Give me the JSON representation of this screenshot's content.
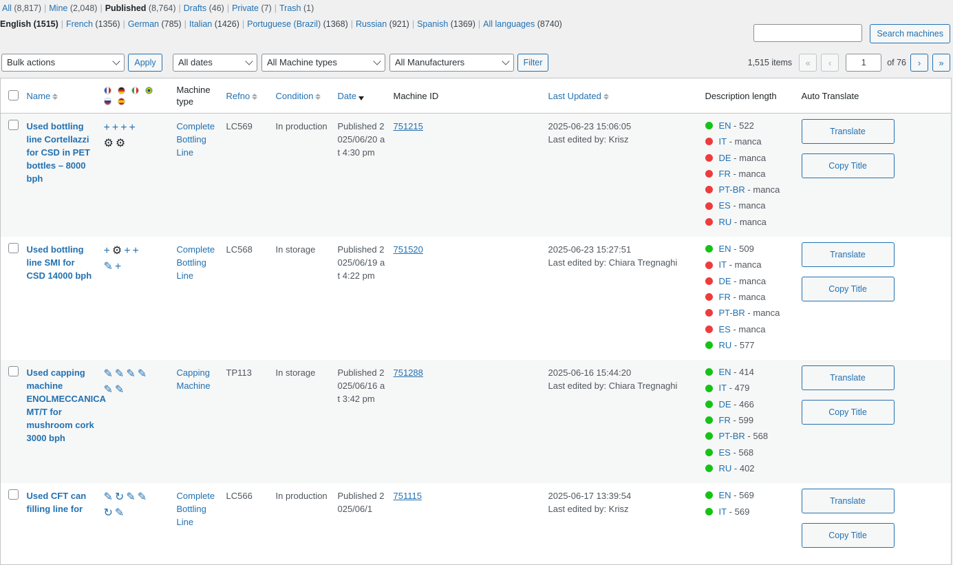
{
  "filters": [
    {
      "label": "All",
      "count": "(8,817)"
    },
    {
      "label": "Mine",
      "count": "(2,048)"
    },
    {
      "label": "Published",
      "count": "(8,764)",
      "current": true
    },
    {
      "label": "Drafts",
      "count": "(46)"
    },
    {
      "label": "Private",
      "count": "(7)"
    },
    {
      "label": "Trash",
      "count": "(1)"
    }
  ],
  "languages": [
    {
      "label": "English",
      "count": "(1515)",
      "current": true
    },
    {
      "label": "French",
      "count": "(1356)"
    },
    {
      "label": "German",
      "count": "(785)"
    },
    {
      "label": "Italian",
      "count": "(1426)"
    },
    {
      "label": "Portuguese (Brazil)",
      "count": "(1368)"
    },
    {
      "label": "Russian",
      "count": "(921)"
    },
    {
      "label": "Spanish",
      "count": "(1369)"
    },
    {
      "label": "All languages",
      "count": "(8740)"
    }
  ],
  "search": {
    "button": "Search machines",
    "value": ""
  },
  "toolbar": {
    "bulk_actions": "Bulk actions",
    "apply": "Apply",
    "dates": "All dates",
    "machine_types": "All Machine types",
    "manufacturers": "All Manufacturers",
    "filter": "Filter"
  },
  "pagination": {
    "items": "1,515 items",
    "first": "«",
    "prev": "‹",
    "current": "1",
    "of": "of 76",
    "next": "›",
    "last": "»"
  },
  "columns": {
    "name": "Name",
    "machine_type": "Machine type",
    "refno": "Refno",
    "condition": "Condition",
    "date": "Date",
    "machine_id": "Machine ID",
    "last_updated": "Last Updated",
    "description_length": "Description length",
    "auto_translate": "Auto Translate"
  },
  "flag_colors": {
    "fr": "#2a52be",
    "de": "#222222",
    "it": "#2e9e3e",
    "br": "#19a33b",
    "ru": "#d52b1e",
    "es": "#e8b300"
  },
  "rows": [
    {
      "title": "Used bottling line Cortellazzi for CSD in PET bottles – 8000 bph",
      "icons": [
        "plus-icon",
        "plus-icon",
        "plus-icon",
        "plus-icon",
        "gear-icon",
        "gear-icon"
      ],
      "machine_type": "Complete Bottling Line",
      "refno": "LC569",
      "condition": "In production",
      "date": "Published 2025/06/20 at 4:30 pm",
      "machine_id": "751215",
      "updated": "2025-06-23 15:06:05",
      "edited": "Last edited by: Krisz",
      "desc": [
        {
          "lang": "EN",
          "value": "522",
          "status": "green"
        },
        {
          "lang": "IT",
          "value": "manca",
          "status": "red"
        },
        {
          "lang": "DE",
          "value": "manca",
          "status": "red"
        },
        {
          "lang": "FR",
          "value": "manca",
          "status": "red"
        },
        {
          "lang": "PT-BR",
          "value": "manca",
          "status": "red"
        },
        {
          "lang": "ES",
          "value": "manca",
          "status": "red"
        },
        {
          "lang": "RU",
          "value": "manca",
          "status": "red"
        }
      ],
      "btn_translate": "Translate",
      "btn_copy": "Copy Title"
    },
    {
      "title": "Used bottling line SMI for CSD 14000 bph",
      "icons": [
        "plus-icon",
        "gear-icon",
        "plus-icon",
        "plus-icon",
        "pencil-icon",
        "plus-icon"
      ],
      "machine_type": "Complete Bottling Line",
      "refno": "LC568",
      "condition": "In storage",
      "date": "Published 2025/06/19 at 4:22 pm",
      "machine_id": "751520",
      "updated": "2025-06-23 15:27:51",
      "edited": "Last edited by: Chiara Tregnaghi",
      "desc": [
        {
          "lang": "EN",
          "value": "509",
          "status": "green"
        },
        {
          "lang": "IT",
          "value": "manca",
          "status": "red"
        },
        {
          "lang": "DE",
          "value": "manca",
          "status": "red"
        },
        {
          "lang": "FR",
          "value": "manca",
          "status": "red"
        },
        {
          "lang": "PT-BR",
          "value": "manca",
          "status": "red"
        },
        {
          "lang": "ES",
          "value": "manca",
          "status": "red"
        },
        {
          "lang": "RU",
          "value": "577",
          "status": "green"
        }
      ],
      "btn_translate": "Translate",
      "btn_copy": "Copy Title"
    },
    {
      "title": "Used capping machine ENOLMECCANICA MT/T for mushroom cork 3000 bph",
      "icons": [
        "pencil-icon",
        "pencil-icon",
        "pencil-icon",
        "pencil-icon",
        "pencil-icon",
        "pencil-icon"
      ],
      "machine_type": "Capping Machine",
      "refno": "TP113",
      "condition": "In storage",
      "date": "Published 2025/06/16 at 3:42 pm",
      "machine_id": "751288",
      "updated": "2025-06-16 15:44:20",
      "edited": "Last edited by: Chiara Tregnaghi",
      "desc": [
        {
          "lang": "EN",
          "value": "414",
          "status": "green"
        },
        {
          "lang": "IT",
          "value": "479",
          "status": "green"
        },
        {
          "lang": "DE",
          "value": "466",
          "status": "green"
        },
        {
          "lang": "FR",
          "value": "599",
          "status": "green"
        },
        {
          "lang": "PT-BR",
          "value": "568",
          "status": "green"
        },
        {
          "lang": "ES",
          "value": "568",
          "status": "green"
        },
        {
          "lang": "RU",
          "value": "402",
          "status": "green"
        }
      ],
      "btn_translate": "Translate",
      "btn_copy": "Copy Title"
    },
    {
      "title": "Used CFT can filling line for",
      "icons": [
        "pencil-icon",
        "refresh-icon",
        "pencil-icon",
        "pencil-icon",
        "refresh-icon",
        "pencil-icon"
      ],
      "machine_type": "Complete Bottling Line",
      "refno": "LC566",
      "condition": "In production",
      "date": "Published 2025/06/1",
      "machine_id": "751115",
      "updated": "2025-06-17 13:39:54",
      "edited": "Last edited by: Krisz",
      "desc": [
        {
          "lang": "EN",
          "value": "569",
          "status": "green"
        },
        {
          "lang": "IT",
          "value": "569",
          "status": "green"
        }
      ],
      "btn_translate": "Translate",
      "btn_copy": "Copy Title"
    }
  ]
}
